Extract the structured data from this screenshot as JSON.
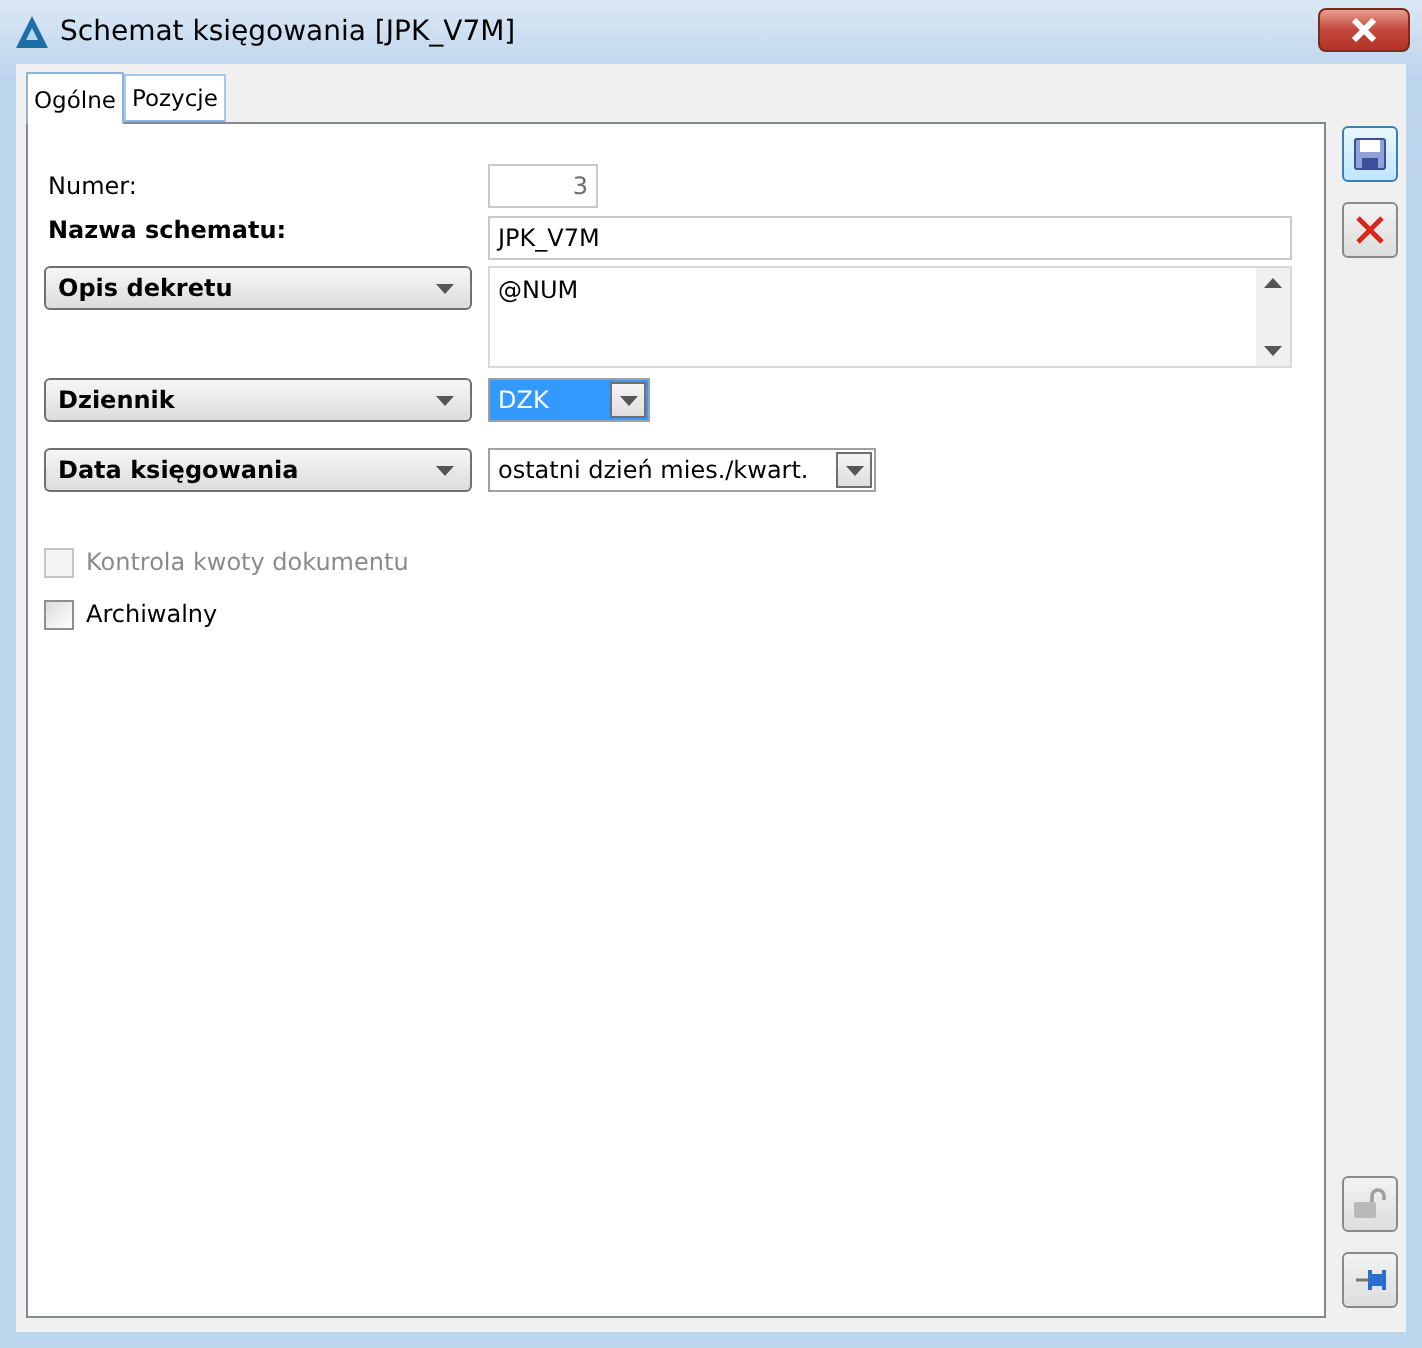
{
  "window": {
    "title": "Schemat księgowania [JPK_V7M]"
  },
  "tabs": [
    {
      "label": "Ogólne",
      "selected": true
    },
    {
      "label": "Pozycje",
      "selected": false
    }
  ],
  "form": {
    "numer": {
      "label": "Numer:",
      "value": "3",
      "disabled": true
    },
    "nazwa": {
      "label": "Nazwa schematu:",
      "value": "JPK_V7M"
    },
    "opis": {
      "label": "Opis dekretu",
      "value": "@NUM"
    },
    "dziennik": {
      "label": "Dziennik",
      "value": "DZK",
      "selected": true
    },
    "data": {
      "label": "Data księgowania",
      "value": "ostatni dzień mies./kwart.",
      "selected": false
    }
  },
  "checkboxes": [
    {
      "label": "Kontrola kwoty dokumentu",
      "checked": false,
      "disabled": true
    },
    {
      "label": "Archiwalny",
      "checked": false,
      "disabled": false
    }
  ]
}
